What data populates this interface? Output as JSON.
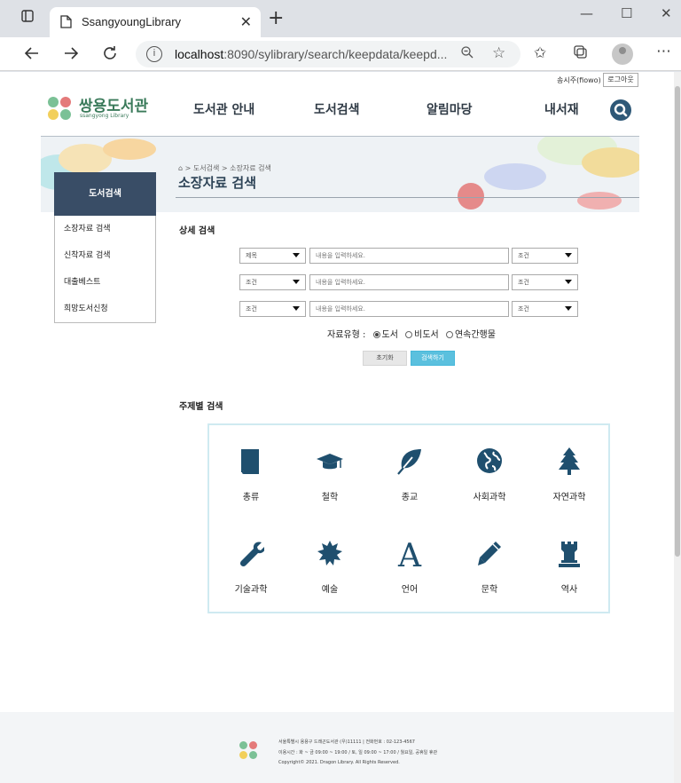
{
  "browser": {
    "tab_title": "SsangyoungLibrary",
    "url_host": "localhost",
    "url_rest": ":8090/sylibrary/search/keepdata/keepd..."
  },
  "header": {
    "user_text": "송시주(fiowo)",
    "logout_label": "로그아웃",
    "logo_name": "쌍용도서관",
    "logo_sub": "ssangyong Library",
    "logo_colors": [
      "#7bc196",
      "#e47a7a",
      "#f2cf5b",
      "#7bc196"
    ],
    "gnb": [
      "도서관 안내",
      "도서검색",
      "알림마당",
      "내서재"
    ],
    "search_icon": "search-icon"
  },
  "banner": {
    "breadcrumb": [
      "도서검색",
      "소장자료 검색"
    ],
    "title": "소장자료 검색"
  },
  "lnb": {
    "heading": "도서검색",
    "items": [
      "소장자료 검색",
      "신착자료 검색",
      "대출베스트",
      "희망도서신청"
    ]
  },
  "detail_search": {
    "title": "상세 검색",
    "rows": [
      {
        "field": "제목",
        "placeholder": "내용을 입력하세요.",
        "condition": "조건"
      },
      {
        "field": "조건",
        "placeholder": "내용을 입력하세요.",
        "condition": "조건"
      },
      {
        "field": "조건",
        "placeholder": "내용을 입력하세요.",
        "condition": "조건"
      }
    ],
    "type_label": "자료유형 :",
    "types": [
      "도서",
      "비도서",
      "연속간행물"
    ],
    "selected_type": "도서",
    "reset_label": "초기화",
    "search_label": "검색하기"
  },
  "subject_search": {
    "title": "주제별 검색",
    "icon_color": "#1f4f6e",
    "items": [
      {
        "label": "총류",
        "icon": "book-icon"
      },
      {
        "label": "철학",
        "icon": "graduation-cap-icon"
      },
      {
        "label": "종교",
        "icon": "leaf-icon"
      },
      {
        "label": "사회과학",
        "icon": "globe-icon"
      },
      {
        "label": "자연과학",
        "icon": "tree-icon"
      },
      {
        "label": "기술과학",
        "icon": "wrench-icon"
      },
      {
        "label": "예술",
        "icon": "star-burst-icon"
      },
      {
        "label": "언어",
        "icon": "letter-a-icon"
      },
      {
        "label": "문학",
        "icon": "pencil-icon"
      },
      {
        "label": "역사",
        "icon": "rook-icon"
      }
    ]
  },
  "footer": {
    "address": "서울특별시 용용구 드래곤도서관 (우)11111 | 전화번호 : 02-123-4567",
    "hours": "이용시간 : 화 ~ 금 09:00 ~ 19:00 / 토, 일 09:00 ~ 17:00 / 월요일, 공휴일 휴관",
    "copyright": "Copyright© 2021. Dragon Library. All Rights Reserved."
  }
}
